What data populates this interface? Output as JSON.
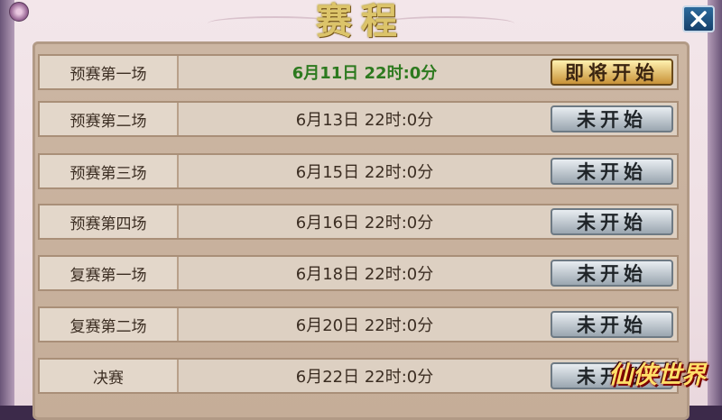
{
  "title": "赛程",
  "close_icon": "close-icon",
  "schedule": [
    {
      "name": "预赛第一场",
      "time": "6月11日 22时:0分",
      "status": "即将开始",
      "active": true
    },
    {
      "name": "预赛第二场",
      "time": "6月13日 22时:0分",
      "status": "未开始",
      "active": false
    },
    {
      "name": "预赛第三场",
      "time": "6月15日 22时:0分",
      "status": "未开始",
      "active": false
    },
    {
      "name": "预赛第四场",
      "time": "6月16日 22时:0分",
      "status": "未开始",
      "active": false
    },
    {
      "name": "复赛第一场",
      "time": "6月18日 22时:0分",
      "status": "未开始",
      "active": false
    },
    {
      "name": "复赛第二场",
      "time": "6月20日 22时:0分",
      "status": "未开始",
      "active": false
    },
    {
      "name": "决赛",
      "time": "6月22日 22时:0分",
      "status": "未开始",
      "active": false
    }
  ],
  "watermark": "仙侠世界",
  "colors": {
    "active_time": "#2d7a1f",
    "title_gold": "#dcc46a"
  }
}
